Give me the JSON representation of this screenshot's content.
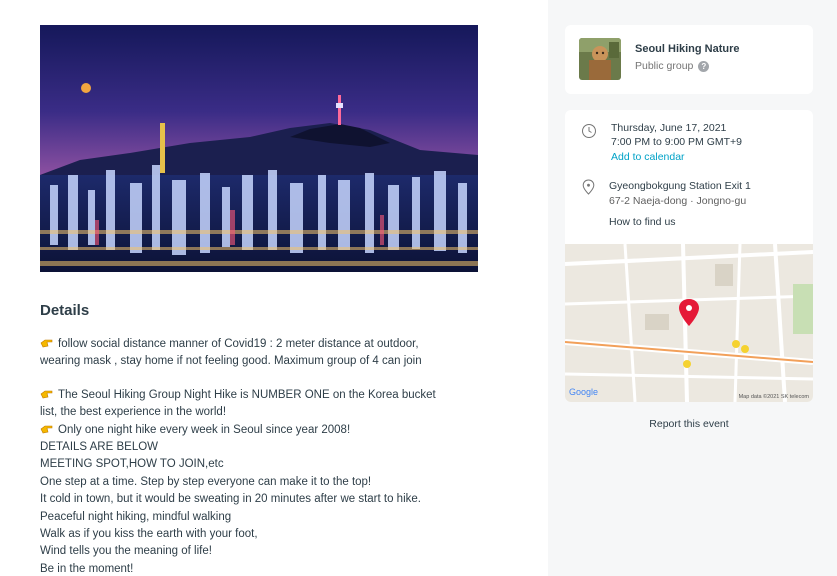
{
  "hero": {
    "icon": "seoul-night-cityscape-image"
  },
  "details": {
    "title": "Details",
    "lines": [
      "follow social distance manner of Covid19 : 2 meter distance at outdoor,",
      "wearing mask , stay home if not feeling good. Maximum group of 4 can join",
      "The Seoul Hiking Group Night Hike is NUMBER ONE on the Korea bucket",
      "list, the best experience in the world!",
      "Only one night hike every week in Seoul since year 2008!",
      "DETAILS ARE BELOW",
      "MEETING SPOT,HOW TO JOIN,etc",
      "One step at a time. Step by step everyone can make it to the top!",
      "It cold in town, but it would be sweating in 20 minutes after we start to hike.",
      "Peaceful night hiking, mindful walking",
      "Walk as if you kiss the earth with your foot,",
      "Wind tells you the meaning of life!",
      "Be in the moment!"
    ]
  },
  "group": {
    "name": "Seoul Hiking Nature",
    "type": "Public group",
    "help_glyph": "?"
  },
  "event": {
    "date": "Thursday, June 17, 2021",
    "time": "7:00 PM to 9:00 PM GMT+9",
    "add_to_calendar": "Add to calendar",
    "venue_name": "Gyeongbokgung Station Exit 1",
    "venue_address": "67-2 Naeja-dong · Jongno-gu",
    "how_to_find": "How to find us"
  },
  "map": {
    "google_label": "Google",
    "attribution": "Map data ©2021 SK telecom",
    "marker_color": "#e51937"
  },
  "report_label": "Report this event",
  "colors": {
    "link": "#00a2c7",
    "text": "#2e3e48",
    "background": "#f6f7f8"
  }
}
